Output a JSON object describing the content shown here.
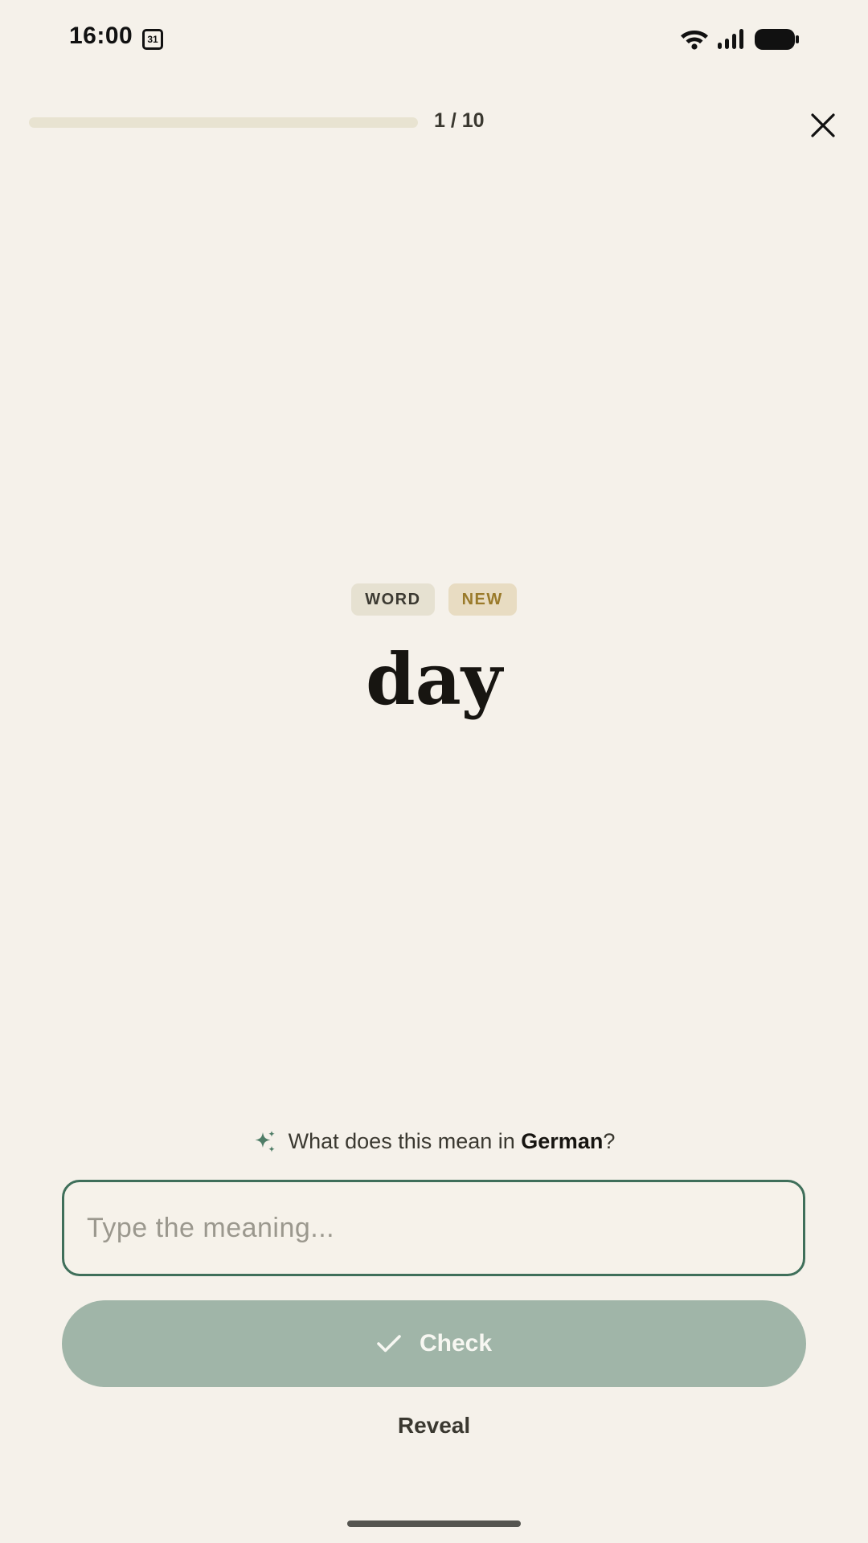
{
  "status_bar": {
    "time": "16:00",
    "calendar_day": "31",
    "icons": [
      "calendar-icon",
      "wifi-icon",
      "signal-icon",
      "battery-icon"
    ]
  },
  "header": {
    "progress_text": "1 / 10",
    "progress_fraction": 0.0,
    "close_icon": "close-icon"
  },
  "card": {
    "tags": [
      "WORD",
      "NEW"
    ],
    "word": "day"
  },
  "prompt": {
    "icon": "sparkle-icon",
    "prefix": "What does this mean in ",
    "language": "German",
    "suffix": "?"
  },
  "input": {
    "placeholder": "Type the meaning...",
    "value": ""
  },
  "actions": {
    "check_label": "Check",
    "check_icon": "checkmark-icon",
    "reveal_label": "Reveal"
  },
  "colors": {
    "background": "#f5f1ea",
    "accent": "#3f6f5a",
    "button_disabled": "#a0b5a8",
    "tag_new_text": "#9a7a2a"
  }
}
